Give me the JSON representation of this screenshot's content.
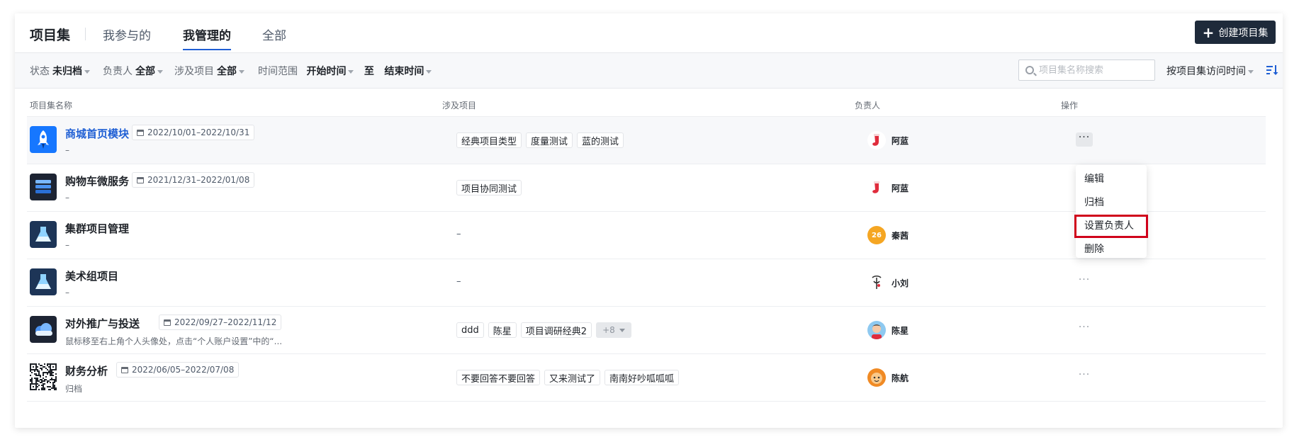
{
  "header": {
    "title": "项目集",
    "tabs": [
      {
        "label": "我参与的"
      },
      {
        "label": "我管理的",
        "active": true
      },
      {
        "label": "全部"
      }
    ],
    "create_label": "创建项目集"
  },
  "filters": {
    "status_label": "状态",
    "status_value": "未归档",
    "owner_label": "负责人",
    "owner_value": "全部",
    "project_label": "涉及项目",
    "project_value": "全部",
    "time_label": "时间范围",
    "time_start": "开始时间",
    "time_to": "至",
    "time_end": "结束时间",
    "search_placeholder": "项目集名称搜索",
    "sort_label": "按项目集访问时间"
  },
  "table": {
    "headers": [
      "项目集名称",
      "涉及项目",
      "负责人",
      "操作"
    ],
    "rows": [
      {
        "name": "商城首页模块",
        "date": "2022/10/01–2022/10/31",
        "desc": "–",
        "tags": [
          "经典项目类型",
          "度量测试",
          "蓝的测试"
        ],
        "owner": "阿蓝",
        "ops": "···"
      },
      {
        "name": "购物车微服务",
        "date": "2021/12/31–2022/01/08",
        "desc": "–",
        "tags": [
          "项目协同测试"
        ],
        "owner": "阿蓝",
        "ops": "···"
      },
      {
        "name": "集群项目管理",
        "desc": "–",
        "dash": "–",
        "owner": "秦茜",
        "owner_badge": "26",
        "ops": "···"
      },
      {
        "name": "美术组项目",
        "desc": "–",
        "dash": "–",
        "owner": "小刘",
        "ops": "···"
      },
      {
        "name": "对外推广与投送",
        "date": "2022/09/27–2022/11/12",
        "desc": "鼠标移至右上角个人头像处，点击“个人账户设置”中的“...",
        "tags": [
          "ddd",
          "陈星",
          "项目调研经典2"
        ],
        "more": "+8",
        "owner": "陈星",
        "ops": "···"
      },
      {
        "name": "财务分析",
        "date": "2022/06/05–2022/07/08",
        "desc": "归档",
        "tags": [
          "不要回答不要回答",
          "又来测试了",
          "南南好吵呱呱呱"
        ],
        "owner": "陈航",
        "ops": "···"
      }
    ]
  },
  "menu": {
    "items": [
      "编辑",
      "归档",
      "设置负责人",
      "删除"
    ],
    "highlight": "#d0021b"
  },
  "colors": {
    "accent": "#1f5fd4",
    "create_bg": "#1e2a3a"
  }
}
